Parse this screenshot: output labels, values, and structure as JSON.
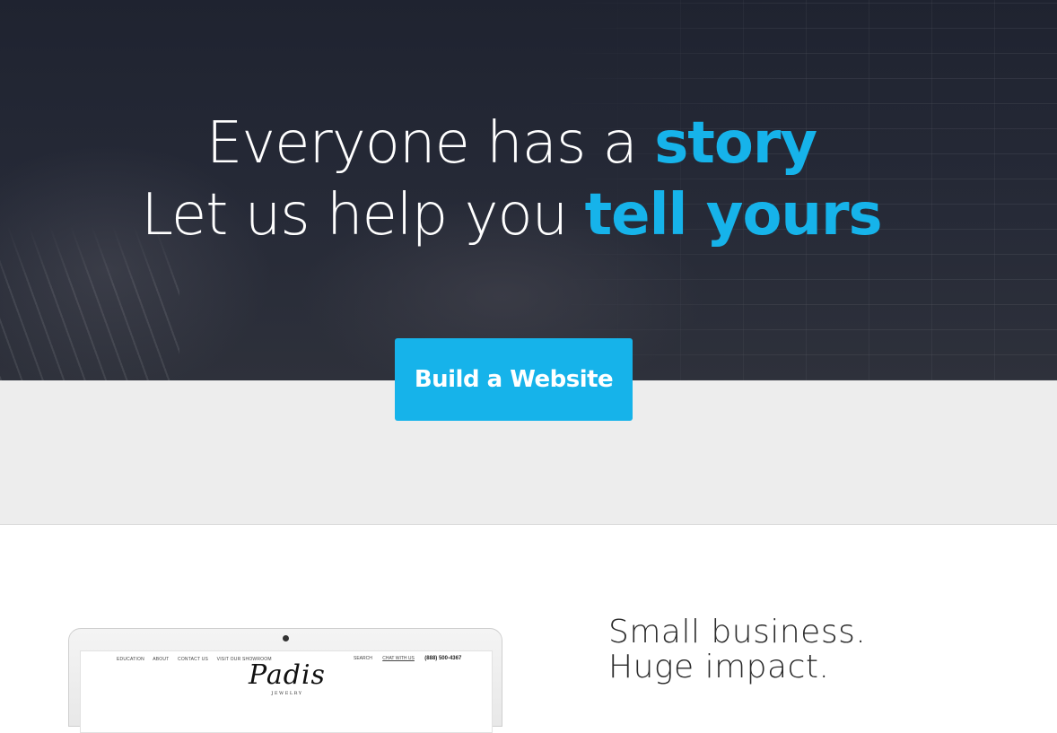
{
  "hero": {
    "line1_prefix": "Everyone has a ",
    "line1_accent": "story",
    "line2_prefix": "Let us help you ",
    "line2_accent": "tell yours",
    "accent_color": "#16b3ea",
    "background_color": "#232735"
  },
  "cta": {
    "label": "Build a Website",
    "color": "#16b3ea"
  },
  "band": {
    "background_color": "#ededed"
  },
  "laptop_preview": {
    "nav_items": [
      "EDUCATION",
      "ABOUT",
      "CONTACT US",
      "VISIT OUR SHOWROOM"
    ],
    "search_label": "SEARCH",
    "chat_label": "CHAT WITH US",
    "phone": "(888) 500-4367",
    "logo_text": "Padis",
    "logo_subtext": "JEWELRY"
  },
  "feature": {
    "line1": "Small business.",
    "line2": "Huge impact."
  }
}
